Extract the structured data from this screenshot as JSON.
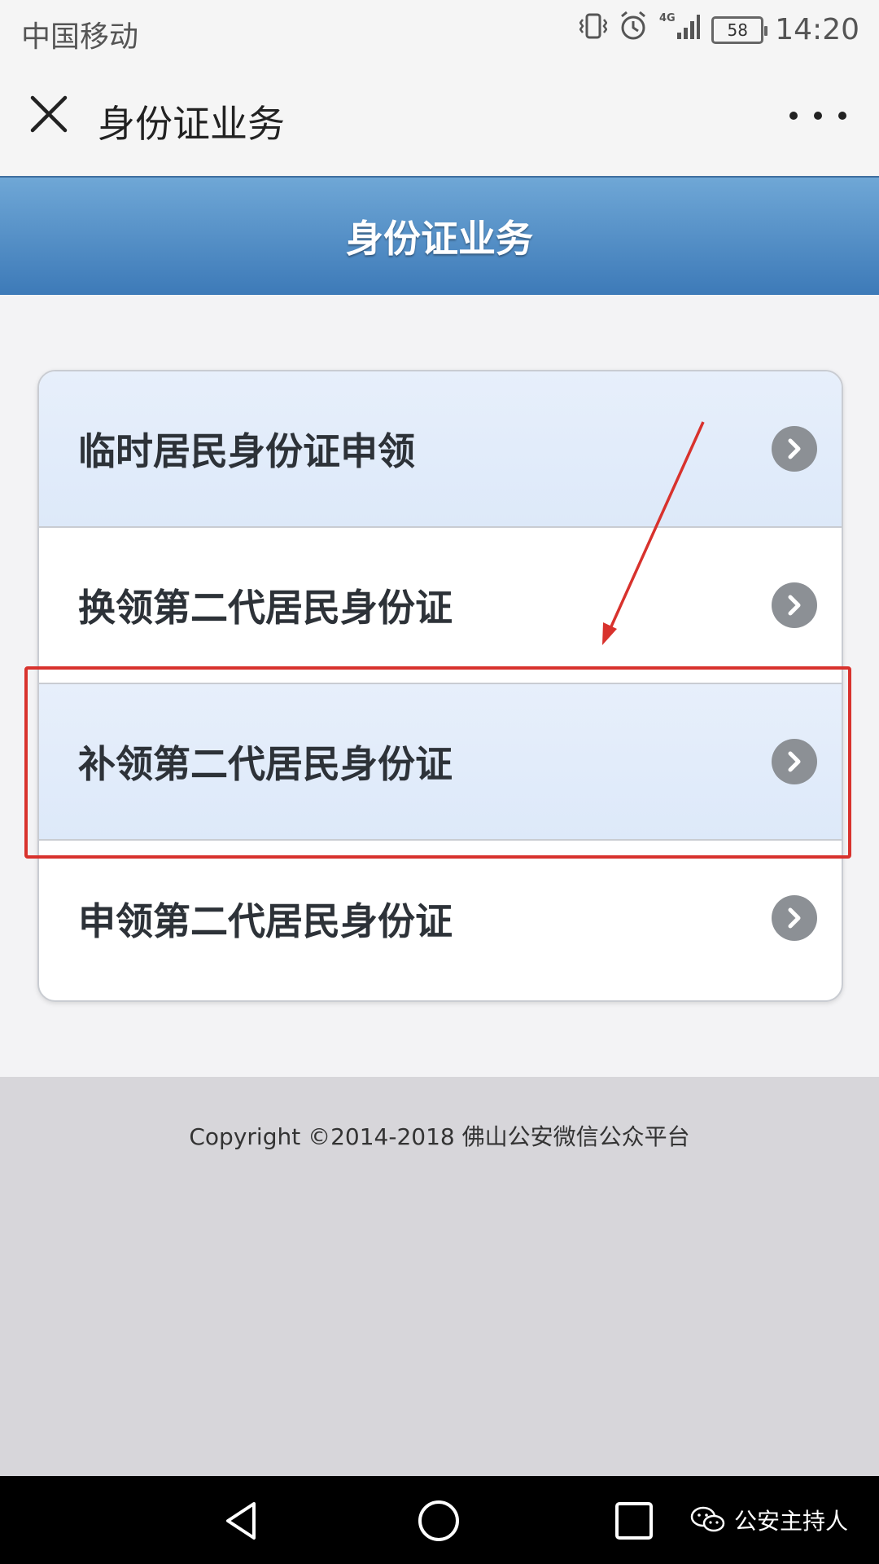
{
  "status_bar": {
    "carrier": "中国移动",
    "network": "4G",
    "battery": "58",
    "time": "14:20"
  },
  "app_header": {
    "title": "身份证业务"
  },
  "banner": {
    "title": "身份证业务"
  },
  "menu": {
    "items": [
      {
        "label": "临时居民身份证申领"
      },
      {
        "label": "换领第二代居民身份证"
      },
      {
        "label": "补领第二代居民身份证"
      },
      {
        "label": "申领第二代居民身份证"
      }
    ]
  },
  "footer": {
    "copyright": "Copyright ©2014-2018 佛山公安微信公众平台"
  },
  "watermark": {
    "text": "公安主持人"
  },
  "colors": {
    "banner_top": "#6fa7d6",
    "banner_bottom": "#3d7ab8",
    "highlight_row": "#e2ecfa",
    "annotation_red": "#d8322d",
    "chevron_gray": "#8c9095"
  }
}
